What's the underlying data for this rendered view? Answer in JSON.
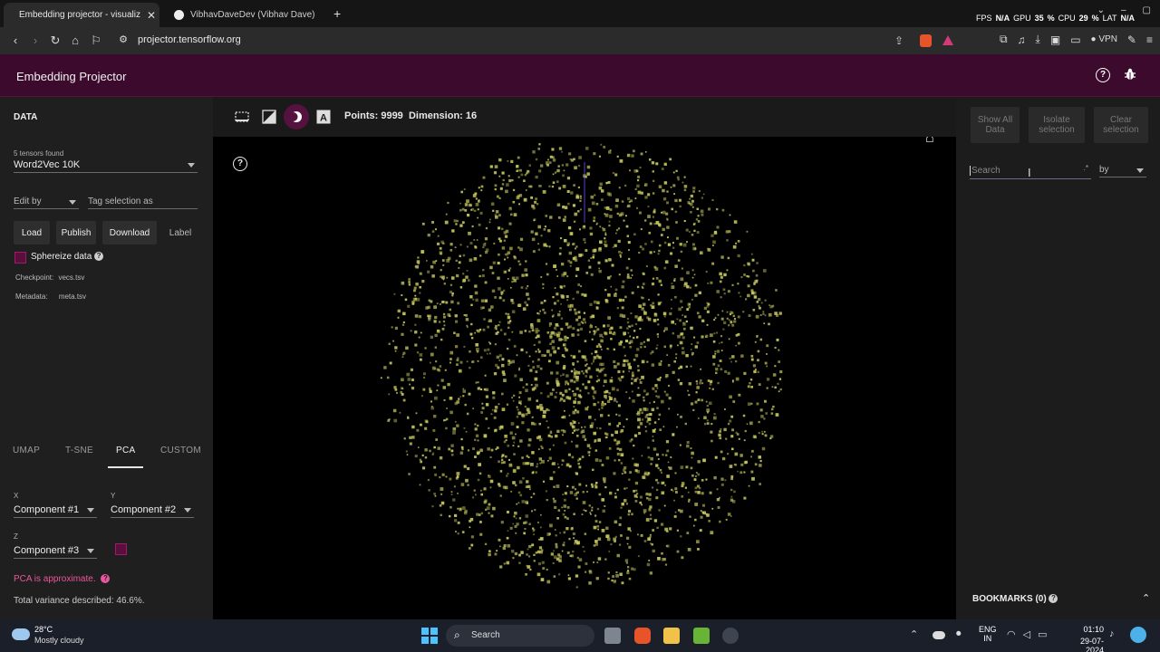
{
  "browser": {
    "tabs": [
      {
        "label": "Embedding projector - visualiz",
        "close": "✕"
      },
      {
        "label": "VibhavDaveDev (Vibhav Dave)"
      }
    ],
    "new_tab": "+",
    "url": "projector.tensorflow.org",
    "vpn": "VPN",
    "stats": {
      "fps_label": "FPS",
      "fps": "N/A",
      "gpu_label": "GPU",
      "gpu": "35",
      "gpu_unit": "%",
      "cpu_label": "CPU",
      "cpu": "29",
      "cpu_unit": "%",
      "lat_label": "LAT",
      "lat": "N/A"
    }
  },
  "app": {
    "title": "Embedding Projector",
    "accent": "#3c0a2c"
  },
  "left": {
    "section": "DATA",
    "tensors_found": "5 tensors found",
    "tensor": "Word2Vec 10K",
    "edit_by": "Edit by",
    "tag_selection": "Tag selection as",
    "buttons": {
      "load": "Load",
      "publish": "Publish",
      "download": "Download",
      "label": "Label"
    },
    "sphereize": "Sphereize data",
    "checkpoint_label": "Checkpoint:",
    "checkpoint": "vecs.tsv",
    "metadata_label": "Metadata:",
    "metadata": "meta.tsv",
    "proj_tabs": [
      "UMAP",
      "T-SNE",
      "PCA",
      "CUSTOM"
    ],
    "active_tab": "PCA",
    "x_label": "X",
    "y_label": "Y",
    "z_label": "Z",
    "x_value": "Component #1",
    "y_value": "Component #2",
    "z_value": "Component #3",
    "pca_note": "PCA is approximate.",
    "variance": "Total variance described: 46.6%."
  },
  "toolbar": {
    "points": "Points: 9999",
    "dimension": "Dimension: 16"
  },
  "right": {
    "show_all": "Show All Data",
    "isolate": "Isolate selection",
    "clear": "Clear selection",
    "search_placeholder": "Search",
    "by": "by",
    "bookmarks": "BOOKMARKS (0)"
  },
  "taskbar": {
    "temp": "28°C",
    "weather": "Mostly cloudy",
    "search": "Search",
    "lang1": "ENG",
    "lang2": "IN",
    "time": "01:10",
    "date": "29-07-2024"
  },
  "point_color": "#c8c860"
}
